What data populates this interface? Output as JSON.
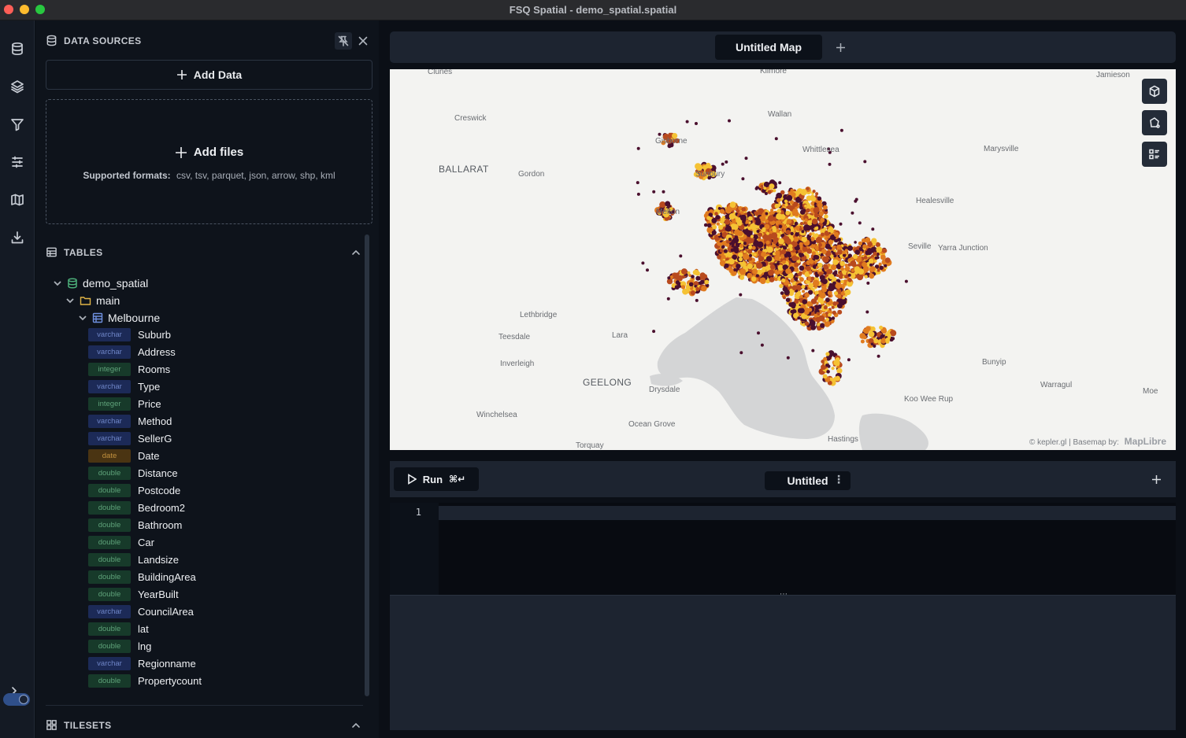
{
  "window": {
    "title": "FSQ Spatial - demo_spatial.spatial"
  },
  "rail": {
    "items": [
      {
        "icon": "database-icon"
      },
      {
        "icon": "layers-icon"
      },
      {
        "icon": "filter-icon"
      },
      {
        "icon": "sliders-icon"
      },
      {
        "icon": "map-icon"
      },
      {
        "icon": "download-icon"
      }
    ],
    "bottom": [
      {
        "icon": "terminal-icon"
      },
      {
        "icon": "theme-toggle"
      }
    ]
  },
  "sidebar": {
    "data_sources_title": "DATA SOURCES",
    "add_data_label": "Add Data",
    "dropzone": {
      "title": "Add files",
      "formats_label": "Supported formats:",
      "formats": "csv, tsv, parquet, json, arrow, shp, kml"
    },
    "tables_title": "TABLES",
    "tilesets_title": "TILESETS",
    "tree": {
      "database": "demo_spatial",
      "schema": "main",
      "table": "Melbourne",
      "fields": [
        {
          "type": "varchar",
          "name": "Suburb"
        },
        {
          "type": "varchar",
          "name": "Address"
        },
        {
          "type": "integer",
          "name": "Rooms"
        },
        {
          "type": "varchar",
          "name": "Type"
        },
        {
          "type": "integer",
          "name": "Price"
        },
        {
          "type": "varchar",
          "name": "Method"
        },
        {
          "type": "varchar",
          "name": "SellerG"
        },
        {
          "type": "date",
          "name": "Date"
        },
        {
          "type": "double",
          "name": "Distance"
        },
        {
          "type": "double",
          "name": "Postcode"
        },
        {
          "type": "double",
          "name": "Bedroom2"
        },
        {
          "type": "double",
          "name": "Bathroom"
        },
        {
          "type": "double",
          "name": "Car"
        },
        {
          "type": "double",
          "name": "Landsize"
        },
        {
          "type": "double",
          "name": "BuildingArea"
        },
        {
          "type": "double",
          "name": "YearBuilt"
        },
        {
          "type": "varchar",
          "name": "CouncilArea"
        },
        {
          "type": "double",
          "name": "lat"
        },
        {
          "type": "double",
          "name": "lng"
        },
        {
          "type": "varchar",
          "name": "Regionname"
        },
        {
          "type": "double",
          "name": "Propertycount"
        }
      ]
    }
  },
  "map_tabs": {
    "active": "Untitled Map"
  },
  "map": {
    "labels": [
      "Clunes",
      "Kilmore",
      "Jamieson",
      "Creswick",
      "Wallan",
      "Gisborne",
      "Whittlesea",
      "Marysville",
      "BALLARAT",
      "Gordon",
      "Sunbury",
      "Healesville",
      "Melton",
      "Seville",
      "Yarra Junction",
      "Lethbridge",
      "Teesdale",
      "Lara",
      "Inverleigh",
      "GEELONG",
      "Drysdale",
      "Bunyip",
      "Warragul",
      "Moe",
      "Koo Wee Rup",
      "Winchelsea",
      "Ocean Grove",
      "Hastings",
      "Torquay"
    ],
    "attribution": "© kepler.gl | Basemap by:",
    "attribution_brand": "MapLibre",
    "colors": {
      "dark": "#4a0f2e",
      "mid": "#b84a1e",
      "orange": "#e07b1f",
      "yellow": "#f5c234"
    }
  },
  "editor": {
    "run_label": "Run",
    "run_shortcut": "⌘↵",
    "query_tab": "Untitled",
    "line_number": "1"
  }
}
